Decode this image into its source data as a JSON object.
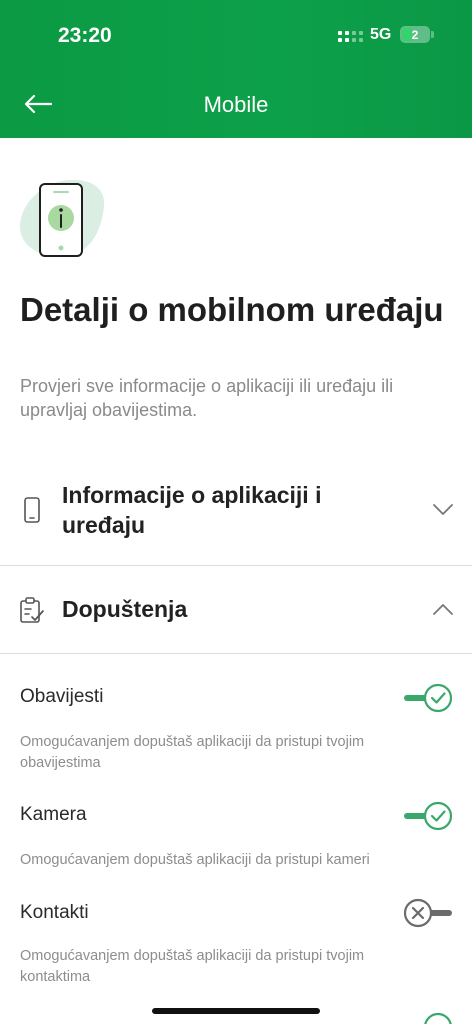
{
  "status_bar": {
    "time": "23:20",
    "network": "5G",
    "battery_percent": "2",
    "battery_color": "#36d26d"
  },
  "nav": {
    "title": "Mobile",
    "back_icon": "arrow-left-icon"
  },
  "hero": {
    "icon": "phone-info-icon",
    "title": "Detalji o mobilnom uređaju",
    "subtitle": "Provjeri sve informacije o aplikaciji ili uređaju ili upravljaj obavijestima."
  },
  "sections": {
    "info": {
      "icon": "phone-icon",
      "title_line1": "Informacije o aplikaciji i",
      "title_line2": "uređaju",
      "state": "collapsed"
    },
    "permissions": {
      "icon": "clipboard-check-icon",
      "title": "Dopuštenja",
      "state": "expanded"
    }
  },
  "permissions": [
    {
      "label": "Obavijesti",
      "description_line1": "Omogućavanjem dopuštaš aplikaciji da pristupi tvojim",
      "description_line2": "obavijestima",
      "enabled": true
    },
    {
      "label": "Kamera",
      "description_line1": "Omogućavanjem dopuštaš aplikaciji da pristupi kameri",
      "description_line2": "",
      "enabled": true
    },
    {
      "label": "Kontakti",
      "description_line1": "Omogućavanjem dopuštaš aplikaciji da pristupi tvojim",
      "description_line2": "kontaktima",
      "enabled": false
    }
  ],
  "colors": {
    "brand_green": "#0da04a",
    "toggle_on": "#3aa86b",
    "toggle_off": "#6b6b6b"
  }
}
